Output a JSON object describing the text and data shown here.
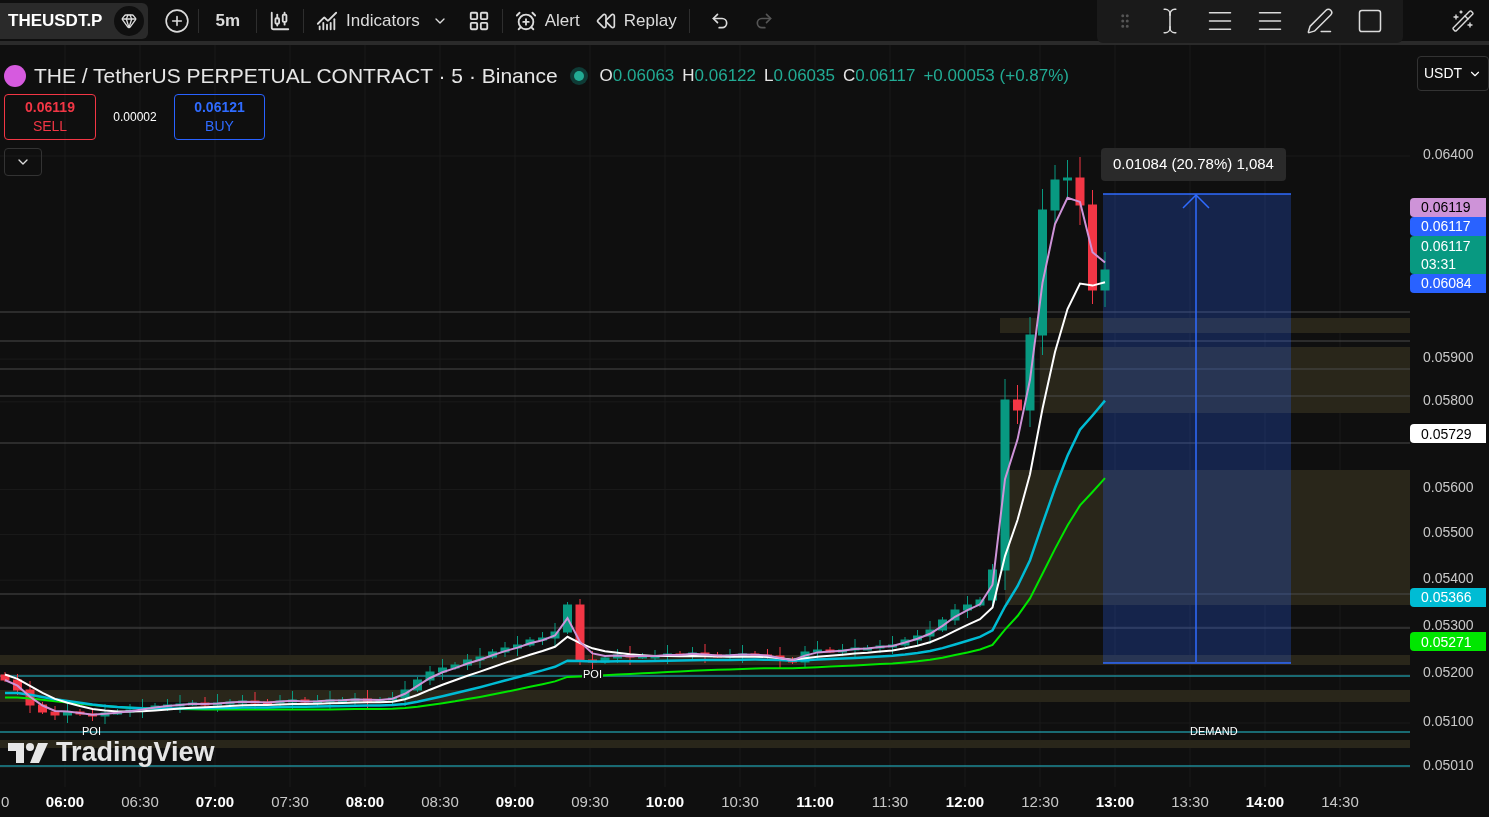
{
  "toolbar": {
    "symbol": "THEUSDT.P",
    "interval": "5m",
    "buttons": [
      {
        "kind": "indicators",
        "label": "Indicators"
      },
      {
        "kind": "alert",
        "label": "Alert"
      },
      {
        "kind": "replay",
        "label": "Replay"
      }
    ],
    "undo": {
      "disabled": false
    },
    "redo": {
      "disabled": true
    }
  },
  "legend": {
    "title": "THE / TetherUS PERPETUAL CONTRACT · 5 · Binance",
    "ohlc": [
      {
        "key": "O",
        "value": "0.06063"
      },
      {
        "key": "H",
        "value": "0.06122"
      },
      {
        "key": "L",
        "value": "0.06035"
      },
      {
        "key": "C",
        "value": "0.06117"
      }
    ],
    "change": "+0.00053 (+0.87%)"
  },
  "trade": {
    "sell": {
      "price": "0.06119",
      "label": "SELL"
    },
    "spread": "0.00002",
    "buy": {
      "price": "0.06121",
      "label": "BUY"
    }
  },
  "currency": "USDT",
  "measure": {
    "label": "0.01084 (20.78%) 1,084"
  },
  "poi_labels": [
    "POI",
    "POI"
  ],
  "zone_label": "DEMAND",
  "branding": "TradingView",
  "price_axis": {
    "ticks": [
      "0.06400",
      "0.05900",
      "0.05800",
      "0.05600",
      "0.05500",
      "0.05400",
      "0.05300",
      "0.05200",
      "0.05100",
      "0.05010"
    ],
    "labels": [
      {
        "value": "0.06119",
        "color": "#ce93d8"
      },
      {
        "value": "0.06117",
        "color": "#2962ff"
      },
      {
        "value": "0.06117",
        "sub": "03:31",
        "color": "#089981"
      },
      {
        "value": "0.06084",
        "color": "#2962ff"
      },
      {
        "value": "0.05729",
        "color": "#ffffff"
      },
      {
        "value": "0.05366",
        "color": "#00bcd4"
      },
      {
        "value": "0.05271",
        "color": "#00e600"
      }
    ]
  },
  "time_axis": [
    {
      "label": "0",
      "major": false
    },
    {
      "label": "06:00",
      "major": true
    },
    {
      "label": "06:30",
      "major": false
    },
    {
      "label": "07:00",
      "major": true
    },
    {
      "label": "07:30",
      "major": false
    },
    {
      "label": "08:00",
      "major": true
    },
    {
      "label": "08:30",
      "major": false
    },
    {
      "label": "09:00",
      "major": true
    },
    {
      "label": "09:30",
      "major": false
    },
    {
      "label": "10:00",
      "major": true
    },
    {
      "label": "10:30",
      "major": false
    },
    {
      "label": "11:00",
      "major": true
    },
    {
      "label": "11:30",
      "major": false
    },
    {
      "label": "12:00",
      "major": true
    },
    {
      "label": "12:30",
      "major": false
    },
    {
      "label": "13:00",
      "major": true
    },
    {
      "label": "13:30",
      "major": false
    },
    {
      "label": "14:00",
      "major": true
    },
    {
      "label": "14:30",
      "major": false
    }
  ]
}
